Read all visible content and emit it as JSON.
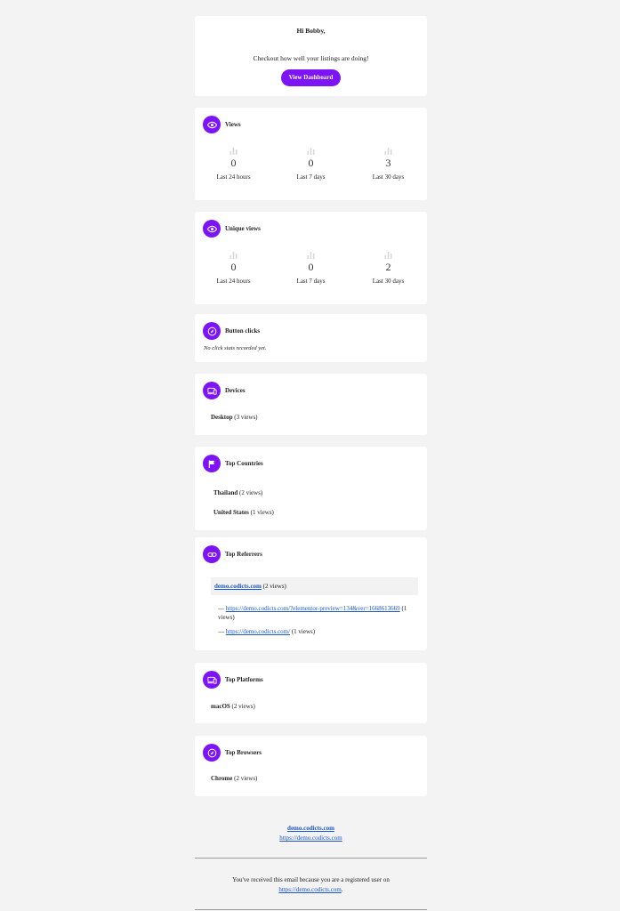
{
  "header": {
    "greeting": "Hi Bobby,",
    "lead": "Checkout how well your listings are doing!",
    "button": "View Dashboard"
  },
  "views": {
    "title": "Views",
    "stats": [
      {
        "value": "0",
        "label": "Last 24 hours"
      },
      {
        "value": "0",
        "label": "Last 7 days"
      },
      {
        "value": "3",
        "label": "Last 30 days"
      }
    ]
  },
  "unique_views": {
    "title": "Unique views",
    "stats": [
      {
        "value": "0",
        "label": "Last 24 hours"
      },
      {
        "value": "0",
        "label": "Last 7 days"
      },
      {
        "value": "2",
        "label": "Last 30 days"
      }
    ]
  },
  "button_clicks": {
    "title": "Button clicks",
    "empty": "No click stats recorded yet."
  },
  "devices": {
    "title": "Devices",
    "items": [
      {
        "name": "Desktop",
        "count": "(3 views)"
      }
    ]
  },
  "countries": {
    "title": "Top Countries",
    "items": [
      {
        "name": "Thailand",
        "count": "(2 views)"
      },
      {
        "name": "United States",
        "count": "(1 views)"
      }
    ]
  },
  "referrers": {
    "title": "Top Referrers",
    "domain": "demo.codicts.com",
    "domain_count": "(2 views)",
    "links": [
      {
        "prefix": "—",
        "url": "https://demo.codicts.com/?elementor-preview=134&ver=1668613669",
        "count": "(1",
        "count2": "views)"
      },
      {
        "prefix": "—",
        "url": "https://demo.codicts.com/",
        "count": "(1 views)"
      }
    ]
  },
  "platforms": {
    "title": "Top Platforms",
    "items": [
      {
        "name": "macOS",
        "count": "(2 views)"
      }
    ]
  },
  "browsers": {
    "title": "Top Browsers",
    "items": [
      {
        "name": "Chrome",
        "count": "(2 views)"
      }
    ]
  },
  "footer": {
    "site_name": "demo.codicts.com",
    "site_url": "https://demo.codicts.com",
    "notice": "You've received this email because you are a registered user on",
    "notice_link": "https://demo.codicts.com",
    "notice_end": "."
  },
  "icons": {
    "views": "eye-icon",
    "unique_views": "eye-icon",
    "button_clicks": "compass-icon",
    "devices": "devices-icon",
    "countries": "flag-icon",
    "referrers": "link-icon",
    "platforms": "devices-icon",
    "browsers": "compass-icon"
  },
  "colors": {
    "accent": "#7c14f5",
    "link": "#1a56c6",
    "background": "#f3f3f3"
  }
}
